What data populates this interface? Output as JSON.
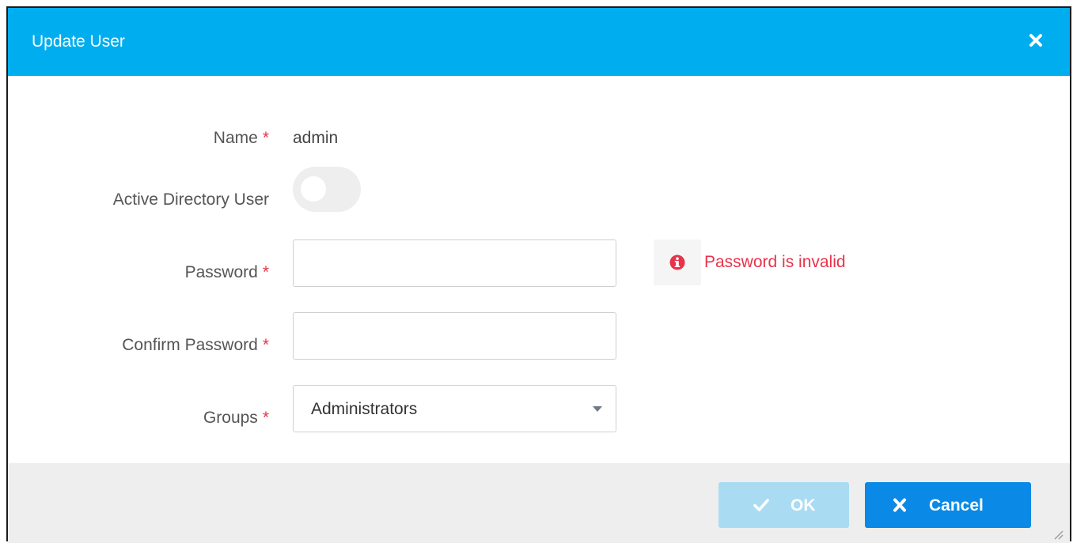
{
  "dialog": {
    "title": "Update User",
    "close_icon": "close-icon"
  },
  "form": {
    "name": {
      "label": "Name",
      "required_mark": "*",
      "value": "admin"
    },
    "active_directory": {
      "label": "Active Directory User",
      "enabled": false
    },
    "password": {
      "label": "Password",
      "required_mark": "*",
      "value": "",
      "error": "Password is invalid",
      "error_icon": "info-circle-icon"
    },
    "confirm_password": {
      "label": "Confirm Password",
      "required_mark": "*",
      "value": ""
    },
    "groups": {
      "label": "Groups",
      "required_mark": "*",
      "selected": "Administrators"
    }
  },
  "footer": {
    "ok_label": "OK",
    "ok_icon": "check-icon",
    "ok_disabled": true,
    "cancel_label": "Cancel",
    "cancel_icon": "close-icon"
  },
  "colors": {
    "header": "#00aeef",
    "error": "#e8334a",
    "ok_disabled": "#a9dcf3",
    "cancel": "#0a8ae6",
    "footer": "#eeeeee"
  }
}
